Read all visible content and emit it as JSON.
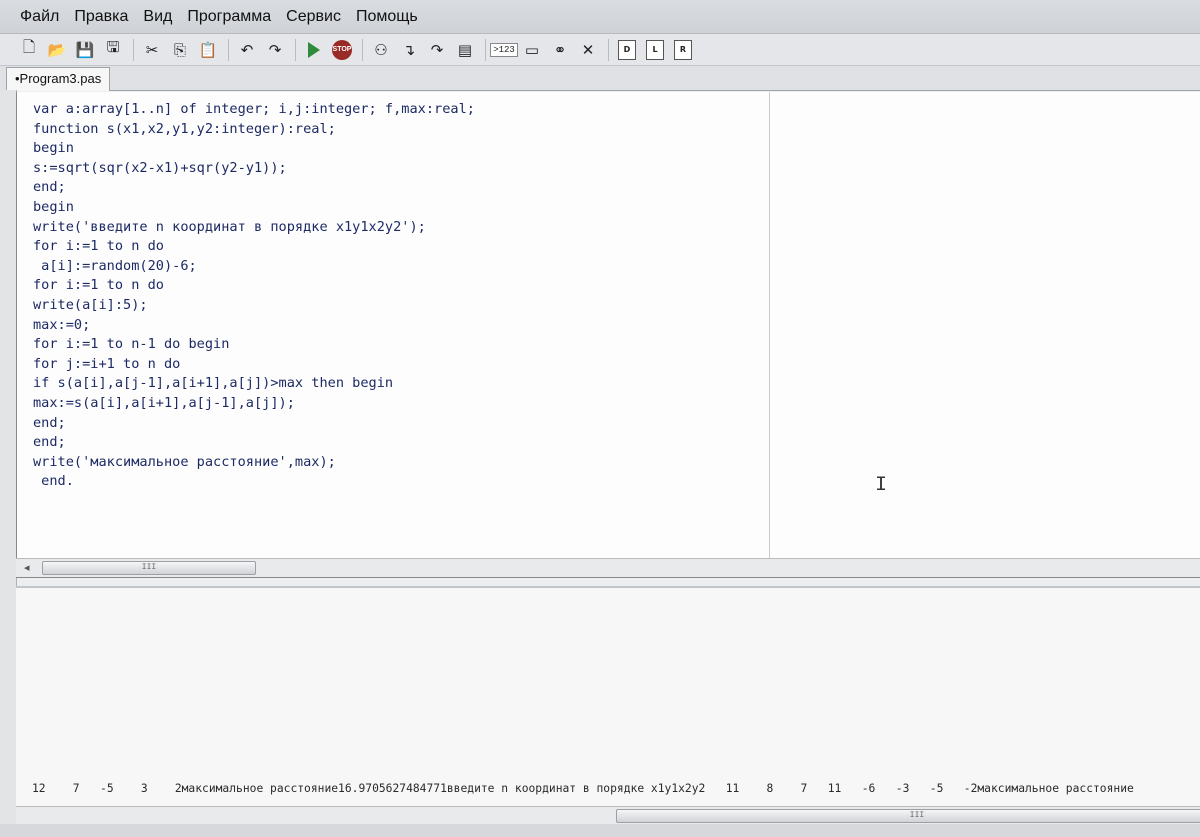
{
  "menu": [
    "Файл",
    "Правка",
    "Вид",
    "Программа",
    "Сервис",
    "Помощь"
  ],
  "toolbar": {
    "stop_label": "STOP",
    "numbers_label": ">123",
    "icons": [
      "new-file-icon",
      "open-file-icon",
      "save-icon",
      "save-all-icon",
      "cut-icon",
      "copy-icon",
      "paste-icon",
      "undo-icon",
      "redo-icon",
      "run-icon",
      "stop-icon",
      "step-icon",
      "step-into-icon",
      "step-over-icon",
      "watch-icon",
      "number-format-icon",
      "window-icon",
      "binoculars-icon",
      "close-icon",
      "doc-d-icon",
      "doc-l-icon",
      "doc-r-icon"
    ]
  },
  "tab": {
    "label": "•Program3.pas"
  },
  "code": [
    "var a:array[1..n] of integer; i,j:integer; f,max:real;",
    "function s(x1,x2,y1,y2:integer):real;",
    "begin",
    "s:=sqrt(sqr(x2-x1)+sqr(y2-y1));",
    "end;",
    "begin",
    "write('введите n координат в порядке x1y1x2y2');",
    "for i:=1 to n do",
    " a[i]:=random(20)-6;",
    "for i:=1 to n do",
    "write(a[i]:5);",
    "max:=0;",
    "for i:=1 to n-1 do begin",
    "for j:=i+1 to n do",
    "if s(a[i],a[j-1],a[i+1],a[j])>max then begin",
    "max:=s(a[i],a[i+1],a[j-1],a[j]);",
    "end;",
    "end;",
    "write('максимальное расстояние',max);",
    " end."
  ],
  "scroll_grip": "III",
  "output": "12    7   -5    3    2максимальное расстояние16.9705627484771введите n координат в порядке x1y1x2y2   11    8    7   11   -6   -3   -5   -2максимальное расстояние"
}
